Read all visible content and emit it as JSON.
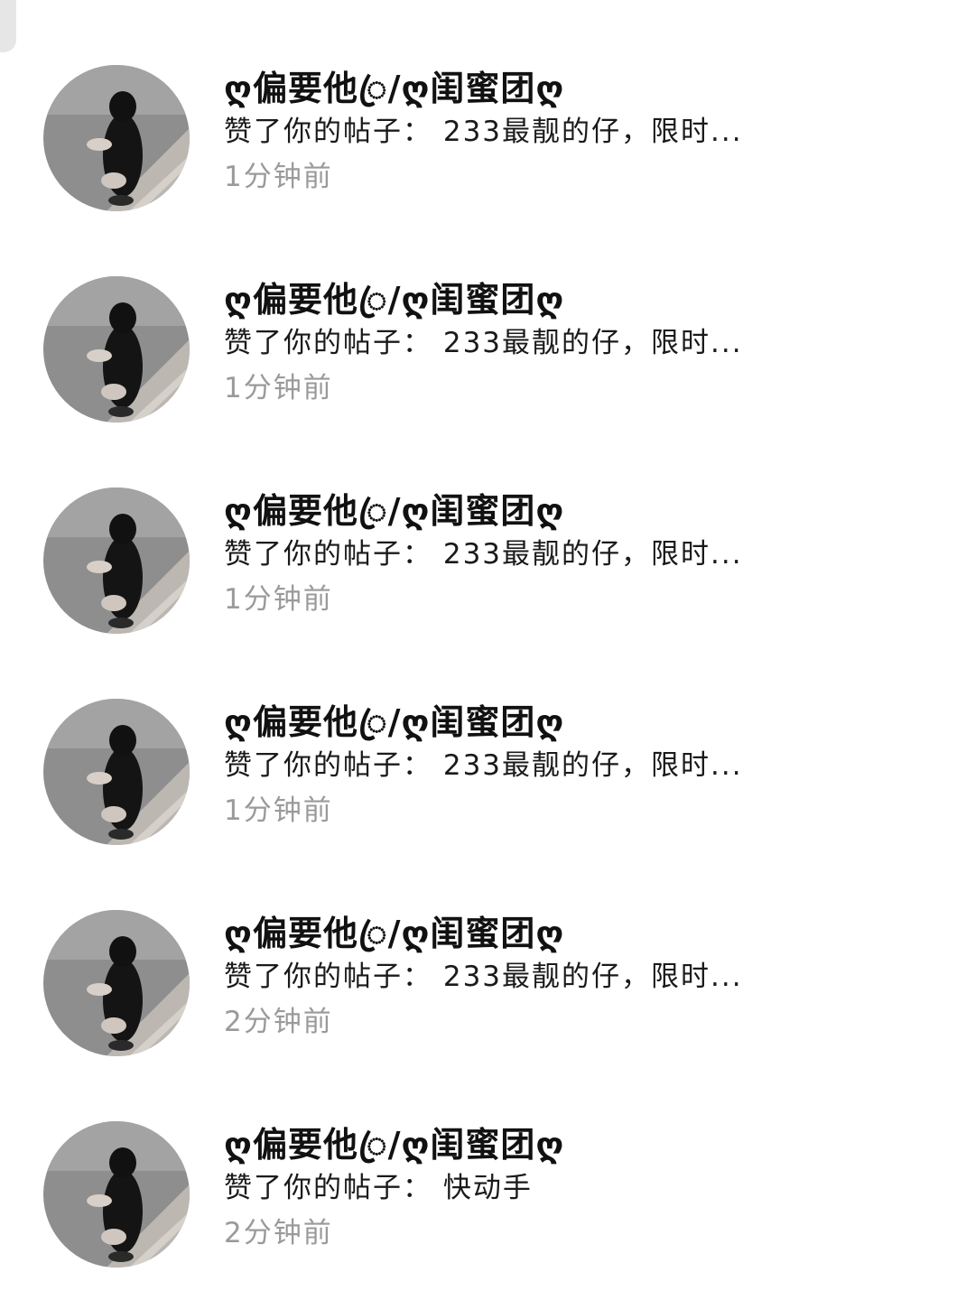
{
  "notifications": [
    {
      "avatar_icon": "user-avatar-girl-long-hair",
      "name": "ღ偏要他ꦿ/ღ闺蜜团ღ",
      "message": "赞了你的帖子： 233最靓的仔，限时...",
      "time": "1分钟前"
    },
    {
      "avatar_icon": "user-avatar-girl-long-hair",
      "name": "ღ偏要他ꦿ/ღ闺蜜团ღ",
      "message": "赞了你的帖子： 233最靓的仔，限时...",
      "time": "1分钟前"
    },
    {
      "avatar_icon": "user-avatar-girl-long-hair",
      "name": "ღ偏要他ꦿ/ღ闺蜜团ღ",
      "message": "赞了你的帖子： 233最靓的仔，限时...",
      "time": "1分钟前"
    },
    {
      "avatar_icon": "user-avatar-girl-long-hair",
      "name": "ღ偏要他ꦿ/ღ闺蜜团ღ",
      "message": "赞了你的帖子： 233最靓的仔，限时...",
      "time": "1分钟前"
    },
    {
      "avatar_icon": "user-avatar-girl-long-hair",
      "name": "ღ偏要他ꦿ/ღ闺蜜团ღ",
      "message": "赞了你的帖子： 233最靓的仔，限时...",
      "time": "2分钟前"
    },
    {
      "avatar_icon": "user-avatar-girl-long-hair",
      "name": "ღ偏要他ꦿ/ღ闺蜜团ღ",
      "message": "赞了你的帖子： 快动手",
      "time": "2分钟前"
    }
  ]
}
